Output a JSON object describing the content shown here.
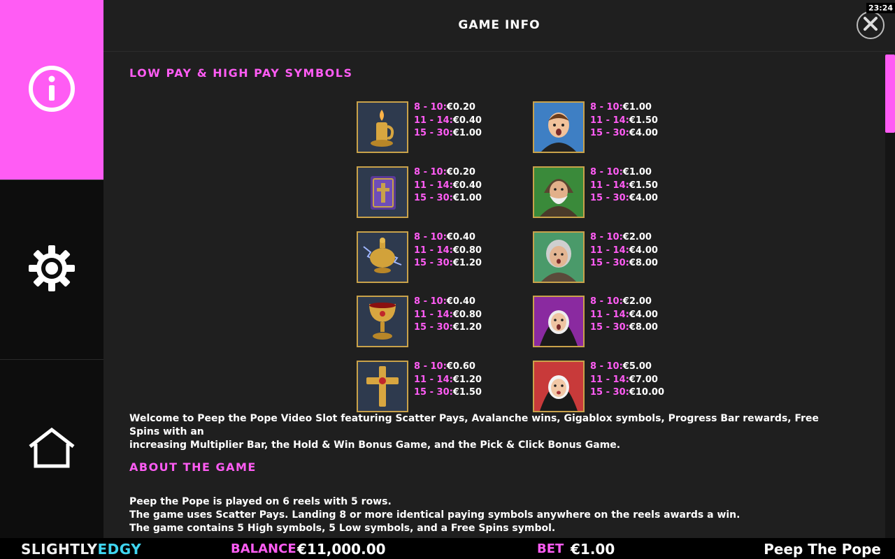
{
  "header": {
    "title": "GAME INFO",
    "clock": "23:24"
  },
  "sidebar": {
    "items": [
      {
        "name": "info",
        "icon": "info-icon",
        "active": true
      },
      {
        "name": "settings",
        "icon": "gear-icon",
        "active": false
      },
      {
        "name": "home",
        "icon": "home-icon",
        "active": false
      }
    ]
  },
  "content": {
    "section1_title": "LOW PAY & HIGH PAY SYMBOLS",
    "low_symbols": [
      {
        "icon": "candle-icon",
        "pays": [
          {
            "range": "8 - 10:",
            "value": "€0.20"
          },
          {
            "range": "11 - 14:",
            "value": "€0.40"
          },
          {
            "range": "15 - 30:",
            "value": "€1.00"
          }
        ]
      },
      {
        "icon": "bible-icon",
        "pays": [
          {
            "range": "8 - 10:",
            "value": "€0.20"
          },
          {
            "range": "11 - 14:",
            "value": "€0.40"
          },
          {
            "range": "15 - 30:",
            "value": "€1.00"
          }
        ]
      },
      {
        "icon": "censer-icon",
        "pays": [
          {
            "range": "8 - 10:",
            "value": "€0.40"
          },
          {
            "range": "11 - 14:",
            "value": "€0.80"
          },
          {
            "range": "15 - 30:",
            "value": "€1.20"
          }
        ]
      },
      {
        "icon": "chalice-icon",
        "pays": [
          {
            "range": "8 - 10:",
            "value": "€0.40"
          },
          {
            "range": "11 - 14:",
            "value": "€0.80"
          },
          {
            "range": "15 - 30:",
            "value": "€1.20"
          }
        ]
      },
      {
        "icon": "cross-icon",
        "pays": [
          {
            "range": "8 - 10:",
            "value": "€0.60"
          },
          {
            "range": "11 - 14:",
            "value": "€1.20"
          },
          {
            "range": "15 - 30:",
            "value": "€1.50"
          }
        ]
      }
    ],
    "high_symbols": [
      {
        "icon": "altar-boy-icon",
        "pays": [
          {
            "range": "8 - 10:",
            "value": "€1.00"
          },
          {
            "range": "11 - 14:",
            "value": "€1.50"
          },
          {
            "range": "15 - 30:",
            "value": "€4.00"
          }
        ]
      },
      {
        "icon": "old-monk-icon",
        "pays": [
          {
            "range": "8 - 10:",
            "value": "€1.00"
          },
          {
            "range": "11 - 14:",
            "value": "€1.50"
          },
          {
            "range": "15 - 30:",
            "value": "€4.00"
          }
        ]
      },
      {
        "icon": "old-woman-icon",
        "pays": [
          {
            "range": "8 - 10:",
            "value": "€2.00"
          },
          {
            "range": "11 - 14:",
            "value": "€4.00"
          },
          {
            "range": "15 - 30:",
            "value": "€8.00"
          }
        ]
      },
      {
        "icon": "shocked-nun-icon",
        "pays": [
          {
            "range": "8 - 10:",
            "value": "€2.00"
          },
          {
            "range": "11 - 14:",
            "value": "€4.00"
          },
          {
            "range": "15 - 30:",
            "value": "€8.00"
          }
        ]
      },
      {
        "icon": "young-nun-icon",
        "pays": [
          {
            "range": "8 - 10:",
            "value": "€5.00"
          },
          {
            "range": "11 - 14:",
            "value": "€7.00"
          },
          {
            "range": "15 - 30:",
            "value": "€10.00"
          }
        ]
      }
    ],
    "welcome_line1": "Welcome to Peep the Pope Video Slot featuring Scatter Pays, Avalanche wins, Gigablox symbols, Progress Bar rewards, Free Spins with an",
    "welcome_line2": "increasing Multiplier Bar, the Hold & Win Bonus Game, and the Pick & Click Bonus Game.",
    "section2_title": "ABOUT THE GAME",
    "about_lines": [
      "Peep the Pope is played on 6 reels with 5 rows.",
      "The game uses Scatter Pays. Landing 8 or more identical paying symbols anywhere on the reels awards a win.",
      "The game contains 5 High symbols, 5 Low symbols, and a Free Spins symbol."
    ]
  },
  "bottom": {
    "logo_part1": "SLIGHTLY",
    "logo_part2": "EDGY",
    "balance_label": "BALANCE",
    "balance_value": "€11,000.00",
    "bet_label": "BET",
    "bet_value": "€1.00",
    "game_name": "Peep The Pope"
  },
  "colors": {
    "accent": "#ff5cf4",
    "background": "#1f1f1f",
    "sidebar": "#0d0d0d",
    "logo_accent": "#3fd5f0"
  }
}
